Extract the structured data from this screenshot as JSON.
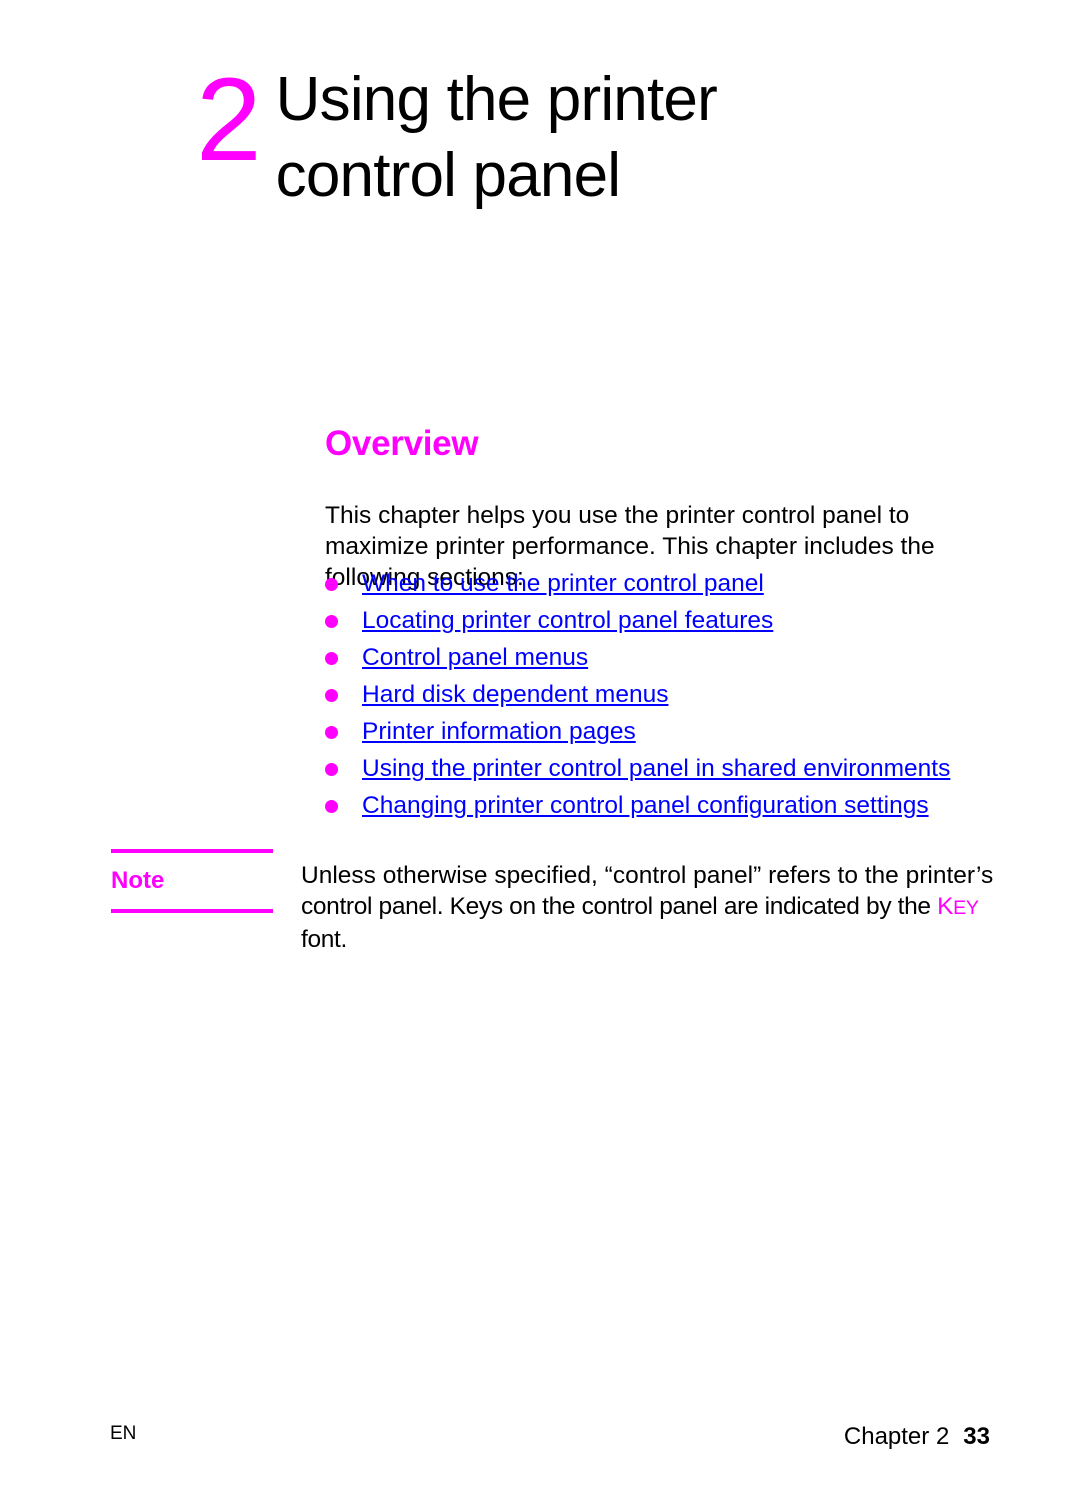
{
  "document": {
    "chapter_number": "2",
    "chapter_title": "Using the printer control panel"
  },
  "overview": {
    "heading": "Overview",
    "intro": "This chapter helps you use the printer control panel to maximize printer performance. This chapter includes the following sections:",
    "links": [
      "When to use the printer control panel",
      "Locating printer control panel features",
      "Control panel menus",
      "Hard disk dependent menus",
      "Printer information pages",
      "Using the printer control panel in shared environments",
      "Changing printer control panel configuration settings"
    ]
  },
  "note": {
    "label": "Note",
    "line1": "Unless otherwise specified, “control panel” refers to the printer’s",
    "line2_before": "control panel. Keys on the control panel are indicated by the ",
    "key_first": "K",
    "key_rest": "EY",
    "line2_after": " font."
  },
  "footer": {
    "language": "EN",
    "chapter_label": "Chapter 2",
    "page_number": "33"
  },
  "colors": {
    "accent_magenta": "#ff00ff",
    "link_blue": "#0000ff",
    "text_black": "#000000"
  }
}
